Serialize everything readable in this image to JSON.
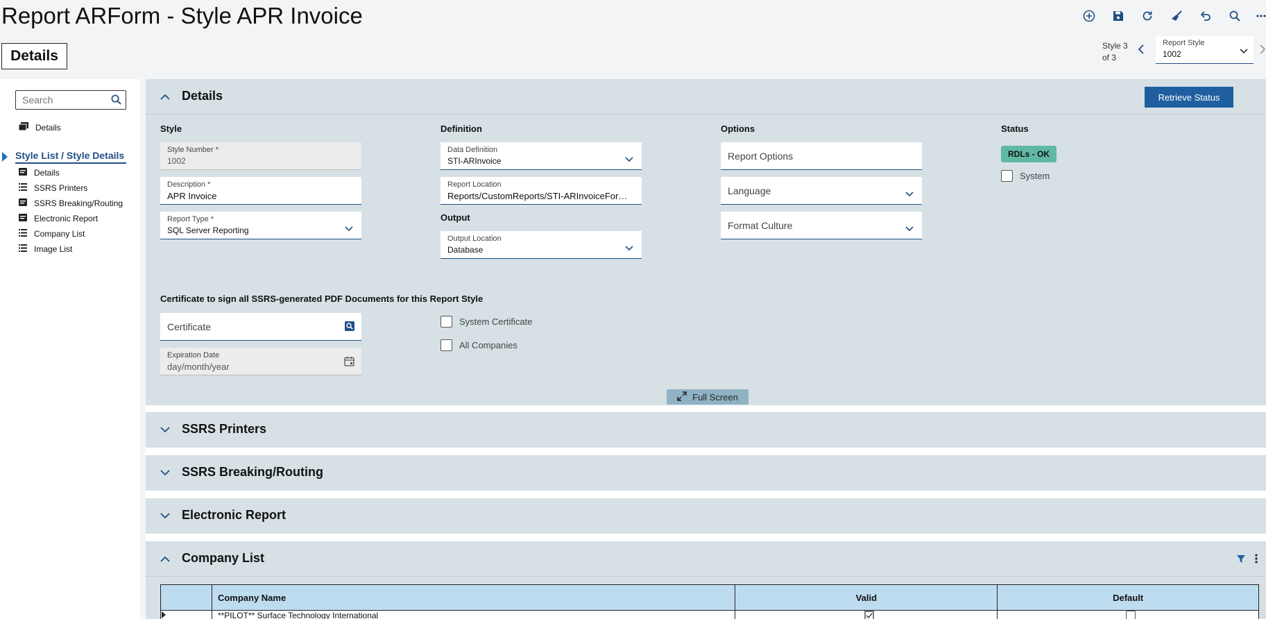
{
  "page": {
    "title": "Report ARForm - Style APR Invoice",
    "tab_label": "Details"
  },
  "toolbar": {
    "icons": [
      "add-icon",
      "save-icon",
      "refresh-icon",
      "clear-icon",
      "undo-icon",
      "search-icon",
      "more-icon"
    ]
  },
  "navigator": {
    "counter_line1": "Style 3",
    "counter_line2": "of 3",
    "select_label": "Report Style",
    "select_value": "1002"
  },
  "sidebar": {
    "search_placeholder": "Search",
    "top_item": "Details",
    "group_label": "Style List / Style Details",
    "items": [
      {
        "label": "Details",
        "icon": "form-icon"
      },
      {
        "label": "SSRS Printers",
        "icon": "list-icon"
      },
      {
        "label": "SSRS Breaking/Routing",
        "icon": "form-icon"
      },
      {
        "label": "Electronic Report",
        "icon": "form-icon"
      },
      {
        "label": "Company List",
        "icon": "list-icon"
      },
      {
        "label": "Image List",
        "icon": "list-icon"
      }
    ]
  },
  "details_panel": {
    "title": "Details",
    "retrieve_button": "Retrieve Status",
    "style": {
      "heading": "Style",
      "style_number_label": "Style Number *",
      "style_number_value": "1002",
      "description_label": "Description *",
      "description_value": "APR Invoice",
      "report_type_label": "Report Type *",
      "report_type_value": "SQL Server Reporting"
    },
    "definition": {
      "heading": "Definition",
      "data_definition_label": "Data Definition",
      "data_definition_value": "STI-ARInvoice",
      "report_location_label": "Report Location",
      "report_location_value": "Reports/CustomReports/STI-ARInvoiceForm/STI-ARInvoiceForm"
    },
    "output": {
      "heading": "Output",
      "output_location_label": "Output Location",
      "output_location_value": "Database"
    },
    "options": {
      "heading": "Options",
      "report_options": "Report Options",
      "language": "Language",
      "format_culture": "Format Culture"
    },
    "status": {
      "heading": "Status",
      "badge": "RDLs - OK",
      "system_label": "System"
    },
    "certificate": {
      "heading": "Certificate to sign all SSRS-generated PDF Documents for this Report Style",
      "certificate_placeholder": "Certificate",
      "expiration_label": "Expiration Date",
      "expiration_placeholder": "day/month/year",
      "system_certificate": "System Certificate",
      "all_companies": "All Companies"
    },
    "full_screen": "Full Screen"
  },
  "panels": {
    "ssrs_printers": "SSRS Printers",
    "ssrs_breaking": "SSRS Breaking/Routing",
    "electronic_report": "Electronic Report",
    "company_list": "Company List"
  },
  "company_table": {
    "headers": [
      "",
      "Company Name",
      "Valid",
      "Default"
    ],
    "rows": [
      {
        "company": "**PILOT** Surface Technology International",
        "valid": true,
        "default": false
      }
    ]
  }
}
